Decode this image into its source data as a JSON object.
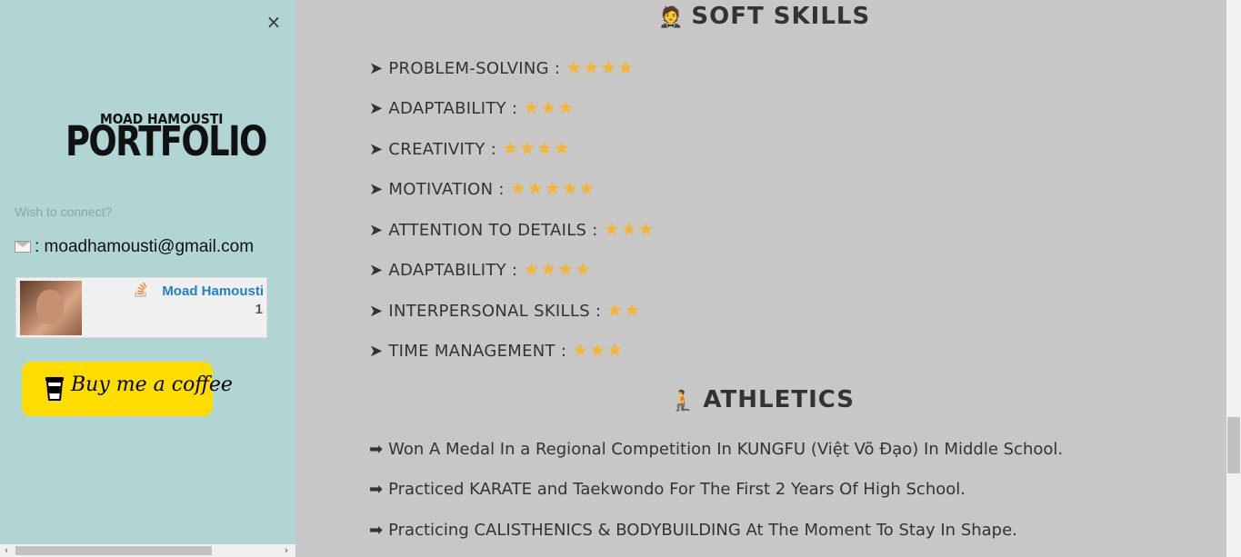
{
  "sidebar": {
    "close_glyph": "×",
    "logo_top": "MOAD HAMOUSTI",
    "logo_main": "PORTFOLIO",
    "connect_text": "Wish to connect?",
    "email_text": ": moadhamousti@gmail.com",
    "stackoverflow": {
      "name": "Moad Hamousti",
      "reputation": "1",
      "icon": "stackoverflow-icon"
    },
    "coffee_label": "Buy me a coffee",
    "scroll_left": "‹",
    "scroll_right": "›"
  },
  "soft_skills": {
    "emoji": "🤵",
    "title": "SOFT SKILLS",
    "items": [
      {
        "arrow": "➤",
        "label": "PROBLEM-SOLVING :",
        "stars": "★★★★",
        "rating": 4
      },
      {
        "arrow": "➤",
        "label": "ADAPTABILITY :",
        "stars": "★★★",
        "rating": 3
      },
      {
        "arrow": "➤",
        "label": "CREATIVITY :",
        "stars": "★★★★",
        "rating": 4
      },
      {
        "arrow": "➤",
        "label": "MOTIVATION :",
        "stars": "★★★★★",
        "rating": 5
      },
      {
        "arrow": "➤",
        "label": "ATTENTION TO DETAILS :",
        "stars": "★★★",
        "rating": 3
      },
      {
        "arrow": "➤",
        "label": "ADAPTABILITY :",
        "stars": "★★★★",
        "rating": 4
      },
      {
        "arrow": "➤",
        "label": "INTERPERSONAL SKILLS :",
        "stars": "★★",
        "rating": 2
      },
      {
        "arrow": "➤",
        "label": "TIME MANAGEMENT :",
        "stars": "★★★",
        "rating": 3
      }
    ]
  },
  "athletics": {
    "emoji": "🧎",
    "title": "ATHLETICS",
    "items": [
      {
        "arrow": "➡",
        "text": "Won A Medal In a Regional Competition In KUNGFU (Việt Võ Đạo) In Middle School."
      },
      {
        "arrow": "➡",
        "text": "Practiced KARATE and Taekwondo For The First 2 Years Of High School."
      },
      {
        "arrow": "➡",
        "text": "Practicing CALISTHENICS & BODYBUILDING At The Moment To Stay In Shape."
      }
    ]
  },
  "colors": {
    "sidebar_bg": "#b1d5d5",
    "main_bg": "#c6c7c6",
    "star": "#f5b431",
    "coffee_bg": "#ffdd00",
    "link": "#1f7fd0"
  }
}
